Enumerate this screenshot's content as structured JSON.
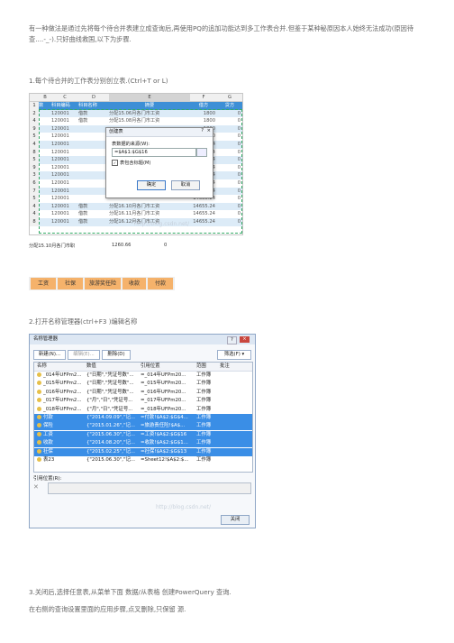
{
  "intro": "有一种做法是通过先将每个待合并表建立成查询后,再使用PQ的追加功能达到多工作表合并.但鉴于某种秘原因本人始终无法成功(原因待查....-_-).只好曲线救国,以下为步骤.",
  "step1": "1.每个待合并的工作表分别创立表.(Ctrl+T or L)",
  "step2": "2.打开名称管理器(ctrl+F3 )编辑名称",
  "step3": "3.关闭后,选择任意表,从菜单下面 数据/从表格 创建PowerQuery 查询.",
  "step4": "在右侧的查询设置里面的应用步骤,点叉删除,只保留 源.",
  "excel": {
    "columns": [
      "B",
      "C",
      "D",
      "E",
      "F",
      "G"
    ],
    "header": [
      "数",
      "科目编码",
      "科目名称",
      "摘要",
      "借方",
      "贷方"
    ],
    "rows": [
      {
        "r": "2",
        "code": "120001",
        "name": "借款",
        "memo": "分配15.06月各门市工资",
        "debit": "1800",
        "credit": "0"
      },
      {
        "r": "4",
        "code": "120001",
        "name": "借款",
        "memo": "分配15.08月各门市工资",
        "debit": "1800",
        "credit": "0"
      },
      {
        "r": "9",
        "code": "120001",
        "name": "",
        "memo": "",
        "debit": "1800",
        "credit": "0"
      },
      {
        "r": "5",
        "code": "120001",
        "name": "",
        "memo": "",
        "debit": "1800",
        "credit": "0"
      },
      {
        "r": "4",
        "code": "120001",
        "name": "",
        "memo": "",
        "debit": "3812.64",
        "credit": "0"
      },
      {
        "r": "8",
        "code": "120001",
        "name": "",
        "memo": "",
        "debit": "14582.64",
        "credit": "0"
      },
      {
        "r": "5",
        "code": "120001",
        "name": "",
        "memo": "",
        "debit": "14582.64",
        "credit": "0"
      },
      {
        "r": "9",
        "code": "120001",
        "name": "",
        "memo": "",
        "debit": "14582.64",
        "credit": "0"
      },
      {
        "r": "3",
        "code": "120001",
        "name": "",
        "memo": "",
        "debit": "14582.64",
        "credit": "0"
      },
      {
        "r": "6",
        "code": "120001",
        "name": "",
        "memo": "",
        "debit": "14655.24",
        "credit": "0"
      },
      {
        "r": "7",
        "code": "120001",
        "name": "",
        "memo": "",
        "debit": "14655.24",
        "credit": "0"
      },
      {
        "r": "5",
        "code": "120001",
        "name": "",
        "memo": "",
        "debit": "14655.24",
        "credit": "0"
      },
      {
        "r": "4",
        "code": "120001",
        "name": "借款",
        "memo": "分配16.10月各门市工资",
        "debit": "14655.24",
        "credit": "0"
      },
      {
        "r": "4",
        "code": "120001",
        "name": "借款",
        "memo": "分配16.11月各门市工资",
        "debit": "14655.24",
        "credit": "0"
      },
      {
        "r": "8",
        "code": "120001",
        "name": "借款",
        "memo": "分配16.12月各门市工资",
        "debit": "14655.24",
        "credit": "0"
      }
    ],
    "dialog": {
      "title": "创建表",
      "help": "?",
      "close": "×",
      "prompt": "表数据的来源(W):",
      "range": "=$A$1:$G$16",
      "checkbox": "表包含标题(M)",
      "check_mark": "✓",
      "ok": "确定",
      "cancel": "取消"
    }
  },
  "strip": {
    "line1": [
      "分配15.10月各门市职",
      "1260.66",
      "0"
    ],
    "tabs": [
      "工资",
      "社保",
      "旅游奖任险",
      "收款",
      "付款"
    ]
  },
  "name_manager": {
    "title": "名称管理器",
    "help": "?",
    "close_x": "×",
    "buttons": [
      "新建(N)...",
      "编辑(E)...",
      "删除(D)",
      "筛选(F) ▾"
    ],
    "headers": [
      "名称",
      "数值",
      "引用位置",
      "范围",
      "批注"
    ],
    "rows": [
      {
        "name": "_014年UFPm2...",
        "value": "{\"日期\",\"凭证号数\"...",
        "ref": "=_014年UFPm20...",
        "scope": "工作簿",
        "sel": false
      },
      {
        "name": "_015年UFPm2...",
        "value": "{\"日期\",\"凭证号数\"...",
        "ref": "=_015年UFPm20...",
        "scope": "工作簿",
        "sel": false
      },
      {
        "name": "_016年UFPm2...",
        "value": "{\"日期\",\"凭证号数\"...",
        "ref": "=_016年UFPm20...",
        "scope": "工作簿",
        "sel": false
      },
      {
        "name": "_017年UFPm2...",
        "value": "{\"月\",\"日\",\"凭证号...",
        "ref": "=_017年UFPm20...",
        "scope": "工作簿",
        "sel": false
      },
      {
        "name": "_018年UFPm2...",
        "value": "{\"月\",\"日\",\"凭证号...",
        "ref": "=_018年UFPm20...",
        "scope": "工作簿",
        "sel": false
      },
      {
        "name": "付款",
        "value": "{\"2014.09.09\",\"记...",
        "ref": "=付款!$A$2:$G$4...",
        "scope": "工作簿",
        "sel": true
      },
      {
        "name": "保险",
        "value": "{\"2015.01.26\",\"记...",
        "ref": "=旅游责任险!$A$...",
        "scope": "工作簿",
        "sel": true
      },
      {
        "name": "工资",
        "value": "{\"2015.06.30\",\"记...",
        "ref": "=工资!$A$2:$G$16",
        "scope": "工作簿",
        "sel": true
      },
      {
        "name": "收款",
        "value": "{\"2014.08.20\",\"记...",
        "ref": "=收款!$A$2:$G$1...",
        "scope": "工作簿",
        "sel": true
      },
      {
        "name": "社保",
        "value": "{\"2015.02.25\",\"记...",
        "ref": "=社保!$A$2:$G$13",
        "scope": "工作簿",
        "sel": true
      },
      {
        "name": "表23",
        "value": "{\"2015.06.30\",\"记...",
        "ref": "=Sheet12!$A$2:$...",
        "scope": "工作簿",
        "sel": false
      }
    ],
    "ref_label": "引用位置(R):",
    "ref_cancel": "✕",
    "close_btn": "关闭",
    "watermark": "http://blog.csdn.net/"
  },
  "excel_watermark": "http://blog.csdn.net/"
}
